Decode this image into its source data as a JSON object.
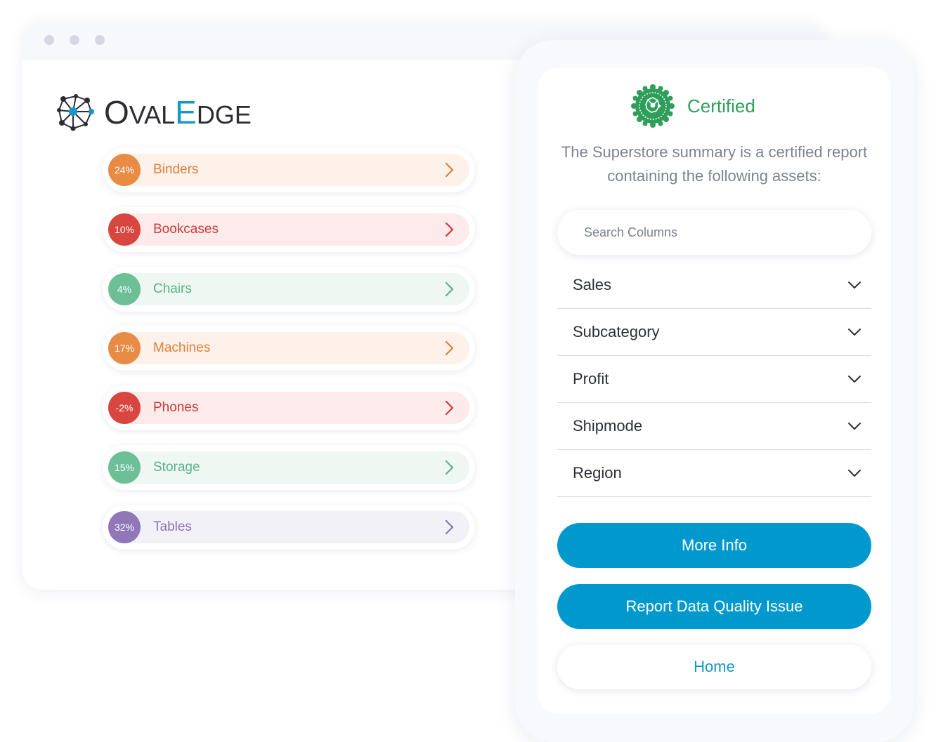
{
  "logo": {
    "part1_big": "O",
    "part1_small": "VAL",
    "part2_big": "E",
    "part3_small": "DGE"
  },
  "categories": [
    {
      "percent": "24%",
      "label": "Binders",
      "color": "#e88b45",
      "bg": "#fdf1ea",
      "text_color": "#e07e36"
    },
    {
      "percent": "10%",
      "label": "Bookcases",
      "color": "#d9463f",
      "bg": "#fcebea",
      "text_color": "#cf3b34"
    },
    {
      "percent": "4%",
      "label": "Chairs",
      "color": "#6cbf97",
      "bg": "#eef7f2",
      "text_color": "#58b286"
    },
    {
      "percent": "17%",
      "label": "Machines",
      "color": "#e88b45",
      "bg": "#fdf1ea",
      "text_color": "#e07e36"
    },
    {
      "percent": "-2%",
      "label": "Phones",
      "color": "#d9463f",
      "bg": "#fcebea",
      "text_color": "#cf3b34"
    },
    {
      "percent": "15%",
      "label": "Storage",
      "color": "#6cbf97",
      "bg": "#eef7f2",
      "text_color": "#58b286"
    },
    {
      "percent": "32%",
      "label": "Tables",
      "color": "#9078b8",
      "bg": "#f3f1f8",
      "text_color": "#8a73b2"
    }
  ],
  "panel": {
    "certified_label": "Certified",
    "summary": "The Superstore summary is a certified report containing the following assets:",
    "search_placeholder": "Search Columns",
    "columns": [
      {
        "label": "Sales"
      },
      {
        "label": "Subcategory"
      },
      {
        "label": "Profit"
      },
      {
        "label": "Shipmode"
      },
      {
        "label": "Region"
      }
    ],
    "buttons": {
      "more_info": "More Info",
      "report_issue": "Report Data Quality Issue",
      "home": "Home"
    }
  },
  "colors": {
    "accent_blue": "#0199cd",
    "certified_green": "#2f9e5a"
  },
  "icons": {
    "logo": "ovaledge-network-logo-icon",
    "seal": "certified-seal-icon",
    "row_chevron": "chevron-right-icon",
    "column_chevron": "chevron-down-icon"
  }
}
